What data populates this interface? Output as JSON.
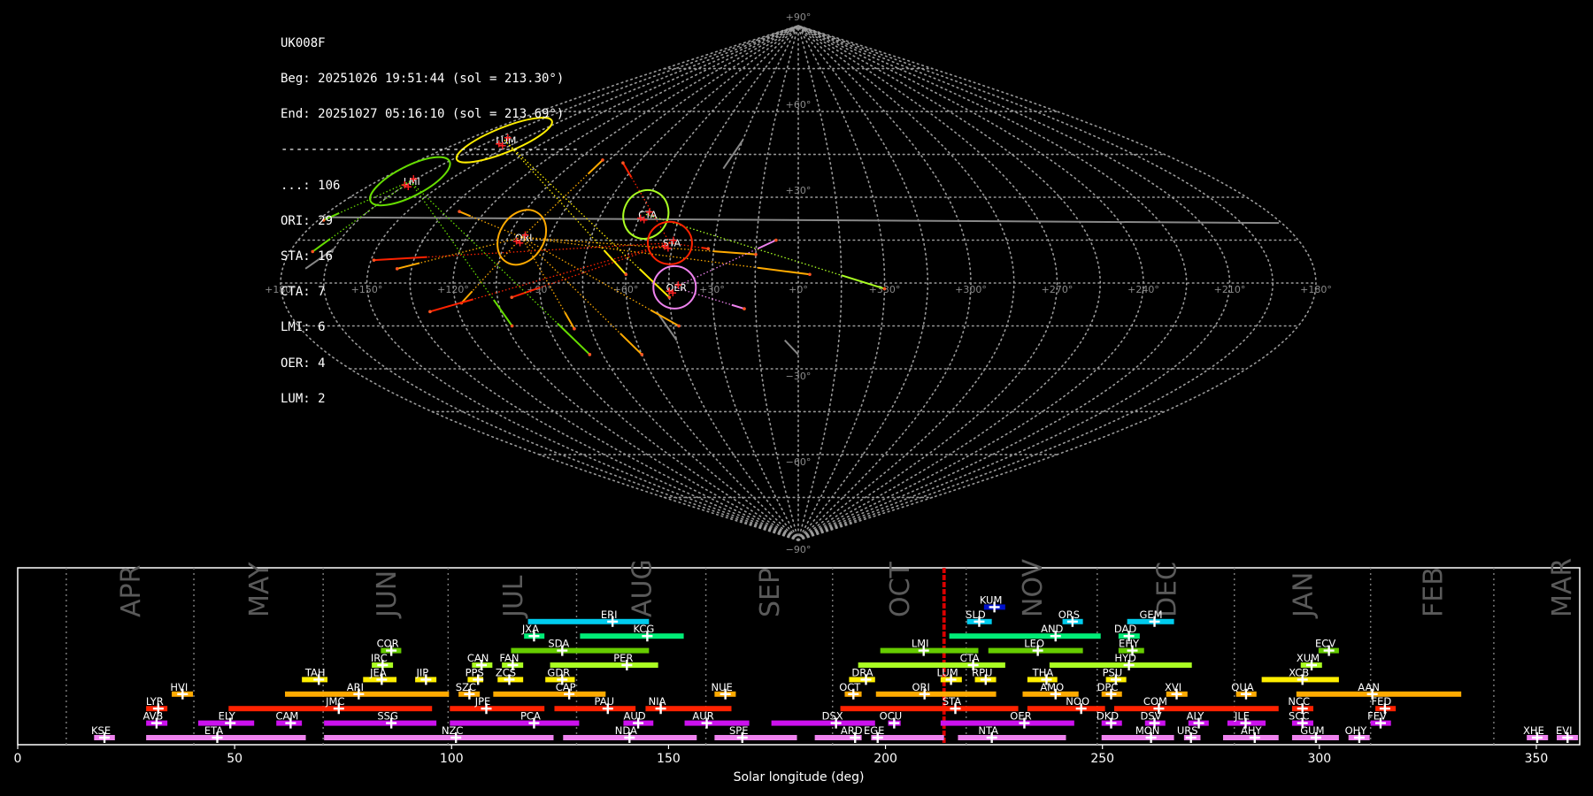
{
  "info": {
    "station": "UK008F",
    "begin": "Beg: 20251026 19:51:44 (sol = 213.30°)",
    "end": "End: 20251027 05:16:10 (sol = 213.69°)",
    "separator": "----------------------------------------",
    "counts": [
      {
        "label": "...: 106"
      },
      {
        "label": "ORI: 29"
      },
      {
        "label": "STA: 16"
      },
      {
        "label": "CTA: 7"
      },
      {
        "label": "LMI: 6"
      },
      {
        "label": "OER: 4"
      },
      {
        "label": "LUM: 2"
      }
    ]
  },
  "chart_data": [
    {
      "type": "scatter",
      "projection": "sinusoidal",
      "grid": true,
      "grid_step_deg": 15,
      "lon_tick_labels": [
        "+180°",
        "+150°",
        "+120°",
        "+90°",
        "+60°",
        "+30°",
        "+0°",
        "+330°",
        "+300°",
        "+270°",
        "+240°",
        "+210°",
        "+180°"
      ],
      "lat_tick_labels": [
        "+90°",
        "+60°",
        "+30°",
        "−30°",
        "−60°",
        "−90°"
      ],
      "radiants": [
        {
          "name": "LUM",
          "ra": 159,
          "dec": 50,
          "color": "#ffee00"
        },
        {
          "name": "LMI",
          "ra": 166,
          "dec": 35.6,
          "color": "#66dd00"
        },
        {
          "name": "ORI",
          "ra": 100,
          "dec": 16,
          "color": "#ffaa00"
        },
        {
          "name": "CTA",
          "ra": 58,
          "dec": 24,
          "color": "#aaff22"
        },
        {
          "name": "STA",
          "ra": 46,
          "dec": 14,
          "color": "#ff2200"
        },
        {
          "name": "OER",
          "ra": 43,
          "dec": -1.5,
          "color": "#ee82ee"
        }
      ],
      "meteors": [
        {
          "shower": "ORI",
          "ra": 15,
          "dec": 10
        },
        {
          "shower": "ORI",
          "ra": 43,
          "dec": -15
        },
        {
          "shower": "ORI",
          "ra": 81,
          "dec": -16
        },
        {
          "shower": "ORI",
          "ra": 118,
          "dec": -7
        },
        {
          "shower": "ORI",
          "ra": 93,
          "dec": 43
        },
        {
          "shower": "ORI",
          "ra": 130,
          "dec": 25
        },
        {
          "shower": "ORI",
          "ra": 356,
          "dec": 3
        },
        {
          "shower": "ORI",
          "ra": 60,
          "dec": -25
        },
        {
          "shower": "ORI",
          "ra": 140,
          "dec": 5
        },
        {
          "shower": "STA",
          "ra": 149,
          "dec": 8
        },
        {
          "shower": "STA",
          "ra": 130,
          "dec": -10
        },
        {
          "shower": "STA",
          "ra": 82,
          "dec": 42
        },
        {
          "shower": "STA",
          "ra": 32,
          "dec": 12
        },
        {
          "shower": "STA",
          "ra": 100,
          "dec": -5
        },
        {
          "shower": "LMI",
          "ra": 178,
          "dec": 22
        },
        {
          "shower": "LMI",
          "ra": 172,
          "dec": 11
        },
        {
          "shower": "LMI",
          "ra": 103,
          "dec": -15
        },
        {
          "shower": "LMI",
          "ra": 80,
          "dec": -25
        },
        {
          "shower": "CTA",
          "ra": 330,
          "dec": -2
        },
        {
          "shower": "LUM",
          "ra": 60,
          "dec": 3
        },
        {
          "shower": "LUM",
          "ra": 45,
          "dec": -5
        },
        {
          "shower": "OER",
          "ra": 19,
          "dec": -9
        },
        {
          "shower": "OER",
          "ra": 8,
          "dec": 15
        }
      ],
      "sporadic_tracks": [
        {
          "ra": 172,
          "dec": 5,
          "ra2": 165,
          "dec2": 12
        },
        {
          "ra": 34,
          "dec": 40,
          "ra2": 30,
          "dec2": 50
        },
        {
          "ra": 50,
          "dec": -10,
          "ra2": 45,
          "dec2": -20
        },
        {
          "ra": 5,
          "dec": -20,
          "ra2": 0,
          "dec2": -25
        },
        {
          "ra": 181,
          "dec": 21,
          "ra2": 179,
          "dec2": 23
        }
      ]
    },
    {
      "type": "bar",
      "xlabel": "Solar longitude (deg)",
      "xlim": [
        0,
        360
      ],
      "xticks": [
        0,
        50,
        100,
        150,
        200,
        250,
        300,
        350
      ],
      "current_sol": [
        213.3,
        213.69
      ],
      "current_color": "#ff0000",
      "months": [
        {
          "name": "APR",
          "start": 11.2
        },
        {
          "name": "MAY",
          "start": 40.6
        },
        {
          "name": "JUN",
          "start": 70.4
        },
        {
          "name": "JUL",
          "start": 99.2
        },
        {
          "name": "AUG",
          "start": 128.8
        },
        {
          "name": "SEP",
          "start": 158.6
        },
        {
          "name": "OCT",
          "start": 187.8
        },
        {
          "name": "NOV",
          "start": 218.6
        },
        {
          "name": "DEC",
          "start": 248.8
        },
        {
          "name": "JAN",
          "start": 280.4
        },
        {
          "name": "FEB",
          "start": 311.8
        },
        {
          "name": "MAR",
          "start": 340.2
        }
      ],
      "row_colors": [
        "#ee82ee",
        "#cc11ee",
        "#ff2200",
        "#ffaa00",
        "#ffee00",
        "#aaff22",
        "#66cc00",
        "#00ee77",
        "#00ccee",
        "#0011cc"
      ],
      "showers": [
        {
          "code": "KSE",
          "row": 0,
          "start": 17.6,
          "end": 22.4,
          "peak": 20.0
        },
        {
          "code": "ETA",
          "row": 0,
          "start": 29.6,
          "end": 66.4,
          "peak": 46.0
        },
        {
          "code": "NZC",
          "row": 0,
          "start": 70.6,
          "end": 123.5,
          "peak": 101.0
        },
        {
          "code": "NDA",
          "row": 0,
          "start": 125.7,
          "end": 156.5,
          "peak": 141.0
        },
        {
          "code": "SPE",
          "row": 0,
          "start": 160.6,
          "end": 179.6,
          "peak": 167.0
        },
        {
          "code": "ARD",
          "row": 0,
          "start": 183.7,
          "end": 194.5,
          "peak": 193.0
        },
        {
          "code": "EGE",
          "row": 0,
          "start": 196.7,
          "end": 213.5,
          "peak": 198.2
        },
        {
          "code": "NTA",
          "row": 0,
          "start": 216.7,
          "end": 241.6,
          "peak": 224.5
        },
        {
          "code": "MON",
          "row": 0,
          "start": 249.8,
          "end": 266.5,
          "peak": 261.2
        },
        {
          "code": "URS",
          "row": 0,
          "start": 268.8,
          "end": 272.6,
          "peak": 270.4
        },
        {
          "code": "AHY",
          "row": 0,
          "start": 277.8,
          "end": 290.6,
          "peak": 285.1
        },
        {
          "code": "GUM",
          "row": 0,
          "start": 293.7,
          "end": 304.5,
          "peak": 299.2
        },
        {
          "code": "OHY",
          "row": 0,
          "start": 306.7,
          "end": 311.6,
          "peak": 309.2
        },
        {
          "code": "XHE",
          "row": 0,
          "start": 347.8,
          "end": 352.7,
          "peak": 350.2
        },
        {
          "code": "EVI",
          "row": 0,
          "start": 354.7,
          "end": 359.6,
          "peak": 357.2
        },
        {
          "code": "AVB",
          "row": 1,
          "start": 29.6,
          "end": 34.5,
          "peak": 32.0
        },
        {
          "code": "ELY",
          "row": 1,
          "start": 41.6,
          "end": 54.5,
          "peak": 49.0
        },
        {
          "code": "CAM",
          "row": 1,
          "start": 59.6,
          "end": 65.5,
          "peak": 62.9
        },
        {
          "code": "SSG",
          "row": 1,
          "start": 70.6,
          "end": 96.5,
          "peak": 86.1
        },
        {
          "code": "PCA",
          "row": 1,
          "start": 99.6,
          "end": 129.4,
          "peak": 119.0
        },
        {
          "code": "AUD",
          "row": 1,
          "start": 139.6,
          "end": 146.5,
          "peak": 143.0
        },
        {
          "code": "AUR",
          "row": 1,
          "start": 153.7,
          "end": 168.6,
          "peak": 158.8
        },
        {
          "code": "DSX",
          "row": 1,
          "start": 173.7,
          "end": 197.6,
          "peak": 188.6
        },
        {
          "code": "OCU",
          "row": 1,
          "start": 200.6,
          "end": 203.5,
          "peak": 202.0
        },
        {
          "code": "OER",
          "row": 1,
          "start": 212.7,
          "end": 243.5,
          "peak": 232.0
        },
        {
          "code": "DKD",
          "row": 1,
          "start": 249.8,
          "end": 254.5,
          "peak": 252.0
        },
        {
          "code": "DSV",
          "row": 1,
          "start": 259.8,
          "end": 264.5,
          "peak": 262.0
        },
        {
          "code": "ALY",
          "row": 1,
          "start": 269.8,
          "end": 274.5,
          "peak": 272.2
        },
        {
          "code": "JLE",
          "row": 1,
          "start": 278.8,
          "end": 287.6,
          "peak": 283.0
        },
        {
          "code": "SCC",
          "row": 1,
          "start": 293.7,
          "end": 298.6,
          "peak": 296.1
        },
        {
          "code": "FEV",
          "row": 1,
          "start": 311.8,
          "end": 316.5,
          "peak": 314.1
        },
        {
          "code": "LYR",
          "row": 2,
          "start": 29.6,
          "end": 34.5,
          "peak": 32.4
        },
        {
          "code": "JMC",
          "row": 2,
          "start": 48.6,
          "end": 95.5,
          "peak": 74.0
        },
        {
          "code": "JPE",
          "row": 2,
          "start": 99.6,
          "end": 121.4,
          "peak": 108.0
        },
        {
          "code": "PAU",
          "row": 2,
          "start": 123.7,
          "end": 142.4,
          "peak": 136.0
        },
        {
          "code": "NIA",
          "row": 2,
          "start": 144.7,
          "end": 164.5,
          "peak": 148.2
        },
        {
          "code": "STA",
          "row": 2,
          "start": 189.6,
          "end": 230.6,
          "peak": 216.1
        },
        {
          "code": "NOO",
          "row": 2,
          "start": 232.7,
          "end": 250.6,
          "peak": 245.1
        },
        {
          "code": "COM",
          "row": 2,
          "start": 252.7,
          "end": 290.6,
          "peak": 263.0
        },
        {
          "code": "NCC",
          "row": 2,
          "start": 293.7,
          "end": 298.6,
          "peak": 296.1
        },
        {
          "code": "FED",
          "row": 2,
          "start": 312.9,
          "end": 317.6,
          "peak": 315.1
        },
        {
          "code": "HVI",
          "row": 3,
          "start": 35.5,
          "end": 40.4,
          "peak": 38.0
        },
        {
          "code": "ARI",
          "row": 3,
          "start": 61.6,
          "end": 99.4,
          "peak": 78.6
        },
        {
          "code": "SZC",
          "row": 3,
          "start": 101.6,
          "end": 106.5,
          "peak": 104.1
        },
        {
          "code": "CAP",
          "row": 3,
          "start": 109.6,
          "end": 135.5,
          "peak": 127.1
        },
        {
          "code": "NUE",
          "row": 3,
          "start": 160.6,
          "end": 165.5,
          "peak": 163.1
        },
        {
          "code": "OCT",
          "row": 3,
          "start": 190.6,
          "end": 194.5,
          "peak": 192.6
        },
        {
          "code": "ORI",
          "row": 3,
          "start": 197.8,
          "end": 225.5,
          "peak": 209.0
        },
        {
          "code": "AMO",
          "row": 3,
          "start": 231.6,
          "end": 244.5,
          "peak": 239.2
        },
        {
          "code": "DPC",
          "row": 3,
          "start": 249.8,
          "end": 254.5,
          "peak": 252.0
        },
        {
          "code": "XVI",
          "row": 3,
          "start": 264.7,
          "end": 269.6,
          "peak": 267.1
        },
        {
          "code": "QUA",
          "row": 3,
          "start": 280.8,
          "end": 285.5,
          "peak": 283.1
        },
        {
          "code": "AAN",
          "row": 3,
          "start": 294.7,
          "end": 332.7,
          "peak": 312.2
        },
        {
          "code": "TAH",
          "row": 4,
          "start": 65.5,
          "end": 71.4,
          "peak": 69.4
        },
        {
          "code": "JEA",
          "row": 4,
          "start": 79.6,
          "end": 87.3,
          "peak": 83.9
        },
        {
          "code": "JIP",
          "row": 4,
          "start": 91.6,
          "end": 96.5,
          "peak": 94.1
        },
        {
          "code": "PPS",
          "row": 4,
          "start": 103.7,
          "end": 107.3,
          "peak": 106.1
        },
        {
          "code": "ZCS",
          "row": 4,
          "start": 110.6,
          "end": 116.5,
          "peak": 113.3
        },
        {
          "code": "GDR",
          "row": 4,
          "start": 121.6,
          "end": 128.4,
          "peak": 125.5
        },
        {
          "code": "DRA",
          "row": 4,
          "start": 191.6,
          "end": 197.6,
          "peak": 195.5
        },
        {
          "code": "LUM",
          "row": 4,
          "start": 212.7,
          "end": 217.6,
          "peak": 215.1
        },
        {
          "code": "RPU",
          "row": 4,
          "start": 220.6,
          "end": 225.5,
          "peak": 223.1
        },
        {
          "code": "THA",
          "row": 4,
          "start": 232.7,
          "end": 239.6,
          "peak": 237.1
        },
        {
          "code": "PSU",
          "row": 4,
          "start": 250.8,
          "end": 255.5,
          "peak": 253.1
        },
        {
          "code": "XCB",
          "row": 4,
          "start": 286.7,
          "end": 304.5,
          "peak": 296.1
        },
        {
          "code": "IRC",
          "row": 5,
          "start": 81.6,
          "end": 86.5,
          "peak": 84.1
        },
        {
          "code": "CAN",
          "row": 5,
          "start": 104.7,
          "end": 109.4,
          "peak": 106.9
        },
        {
          "code": "FAN",
          "row": 5,
          "start": 111.6,
          "end": 116.5,
          "peak": 114.1
        },
        {
          "code": "PER",
          "row": 5,
          "start": 122.7,
          "end": 147.6,
          "peak": 140.4
        },
        {
          "code": "CTA",
          "row": 5,
          "start": 193.7,
          "end": 227.6,
          "peak": 220.2
        },
        {
          "code": "HYD",
          "row": 5,
          "start": 237.8,
          "end": 270.6,
          "peak": 256.1
        },
        {
          "code": "XUM",
          "row": 5,
          "start": 295.7,
          "end": 300.6,
          "peak": 298.2
        },
        {
          "code": "COR",
          "row": 6,
          "start": 83.7,
          "end": 88.4,
          "peak": 86.1
        },
        {
          "code": "SDA",
          "row": 6,
          "start": 113.7,
          "end": 145.5,
          "peak": 125.5
        },
        {
          "code": "LMI",
          "row": 6,
          "start": 198.8,
          "end": 221.4,
          "peak": 208.8
        },
        {
          "code": "LEO",
          "row": 6,
          "start": 223.7,
          "end": 245.5,
          "peak": 235.1
        },
        {
          "code": "EHY",
          "row": 6,
          "start": 253.7,
          "end": 259.6,
          "peak": 256.9
        },
        {
          "code": "ECV",
          "row": 6,
          "start": 299.8,
          "end": 304.5,
          "peak": 302.2
        },
        {
          "code": "JXA",
          "row": 7,
          "start": 116.7,
          "end": 121.4,
          "peak": 119.0
        },
        {
          "code": "KCG",
          "row": 7,
          "start": 129.6,
          "end": 153.5,
          "peak": 145.1
        },
        {
          "code": "AND",
          "row": 7,
          "start": 214.7,
          "end": 249.6,
          "peak": 239.2
        },
        {
          "code": "DAD",
          "row": 7,
          "start": 253.7,
          "end": 258.6,
          "peak": 256.1
        },
        {
          "code": "ERI",
          "row": 8,
          "start": 117.6,
          "end": 145.5,
          "peak": 137.1
        },
        {
          "code": "SLD",
          "row": 8,
          "start": 218.8,
          "end": 224.5,
          "peak": 221.6
        },
        {
          "code": "ORS",
          "row": 8,
          "start": 240.8,
          "end": 245.5,
          "peak": 243.1
        },
        {
          "code": "GEM",
          "row": 8,
          "start": 255.7,
          "end": 266.5,
          "peak": 262.0
        },
        {
          "code": "KUM",
          "row": 9,
          "start": 222.7,
          "end": 227.6,
          "peak": 225.1
        }
      ]
    }
  ]
}
